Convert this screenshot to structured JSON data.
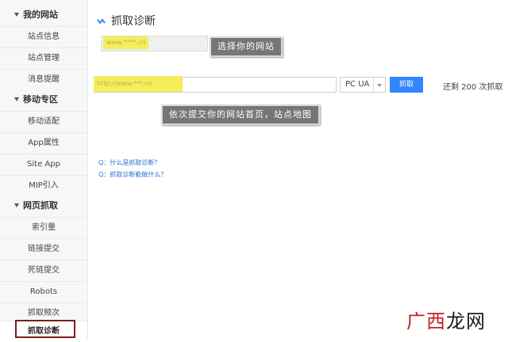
{
  "sidebar": {
    "groups": [
      {
        "title": "我的网站",
        "items": [
          "站点信息",
          "站点管理",
          "消息提醒"
        ]
      },
      {
        "title": "移动专区",
        "items": [
          "移动适配",
          "App属性",
          "Site App",
          "MIP引入"
        ]
      },
      {
        "title": "网页抓取",
        "items": [
          "索引量",
          "链接提交",
          "死链提交",
          "Robots",
          "抓取频次",
          "抓取诊断"
        ]
      }
    ]
  },
  "main": {
    "title": "抓取诊断",
    "site_value": "www.****.cn",
    "url_value": "http://www.***.cn",
    "ua_value": "PC UA",
    "submit_label": "抓取",
    "remaining": "还剩 200 次抓取",
    "faq": [
      "Q：什么是抓取诊断？",
      "Q：抓取诊断能做什么？"
    ]
  },
  "annotations": {
    "tip1": "选择你的网站",
    "tip2": "依次提交你的网站首页，站点地图"
  },
  "watermark": {
    "red": "广西",
    "dark": "龙网"
  }
}
